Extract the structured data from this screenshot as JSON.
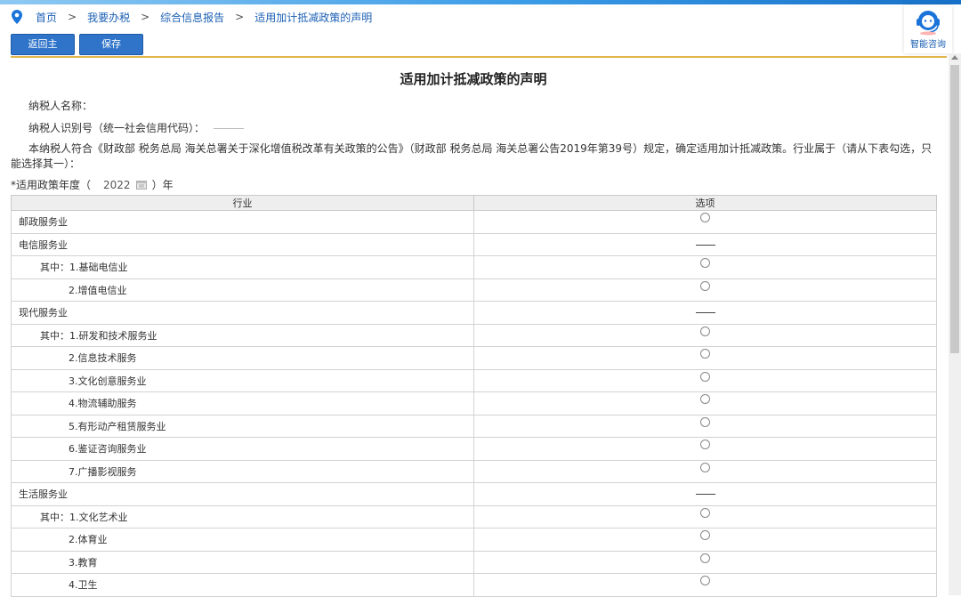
{
  "breadcrumb": {
    "items": [
      "首页",
      "我要办税",
      "综合信息报告",
      "适用加计抵减政策的声明"
    ],
    "separator": ">"
  },
  "toolbar": {
    "home_label": "返回主页",
    "save_label": "保存"
  },
  "consult": {
    "label": "智能咨询"
  },
  "form": {
    "title": "适用加计抵减政策的声明",
    "taxpayer_name_label": "纳税人名称：",
    "taxpayer_id_label": "纳税人识别号（统一社会信用代码）：",
    "statement": "本纳税人符合《财政部 税务总局 海关总署关于深化增值税改革有关政策的公告》（财政部 税务总局 海关总署公告2019年第39号）规定，确定适用加计抵减政策。行业属于（请从下表勾选，只能选择其一）：",
    "year_label": "*适用政策年度（",
    "year_value": "2022",
    "year_suffix": "）年"
  },
  "table": {
    "headers": [
      "行业",
      "选项"
    ],
    "rows": [
      {
        "label": "邮政服务业",
        "level": 0,
        "option": "radio"
      },
      {
        "label": "电信服务业",
        "level": 0,
        "option": "dash"
      },
      {
        "label": "其中：1.基础电信业",
        "level": 1,
        "option": "radio"
      },
      {
        "label": "2.增值电信业",
        "level": 2,
        "option": "radio"
      },
      {
        "label": "现代服务业",
        "level": 0,
        "option": "dash"
      },
      {
        "label": "其中：1.研发和技术服务业",
        "level": 1,
        "option": "radio"
      },
      {
        "label": "2.信息技术服务",
        "level": 2,
        "option": "radio"
      },
      {
        "label": "3.文化创意服务业",
        "level": 2,
        "option": "radio"
      },
      {
        "label": "4.物流辅助服务",
        "level": 2,
        "option": "radio"
      },
      {
        "label": "5.有形动产租赁服务业",
        "level": 2,
        "option": "radio"
      },
      {
        "label": "6.鉴证咨询服务业",
        "level": 2,
        "option": "radio"
      },
      {
        "label": "7.广播影视服务",
        "level": 2,
        "option": "radio"
      },
      {
        "label": "生活服务业",
        "level": 0,
        "option": "dash"
      },
      {
        "label": "其中：1.文化艺术业",
        "level": 1,
        "option": "radio"
      },
      {
        "label": "2.体育业",
        "level": 2,
        "option": "radio"
      },
      {
        "label": "3.教育",
        "level": 2,
        "option": "radio"
      },
      {
        "label": "4.卫生",
        "level": 2,
        "option": "radio"
      }
    ]
  },
  "colors": {
    "accent": "#2f74c9",
    "divider": "#e3b64d",
    "link": "#1a5fb4"
  }
}
